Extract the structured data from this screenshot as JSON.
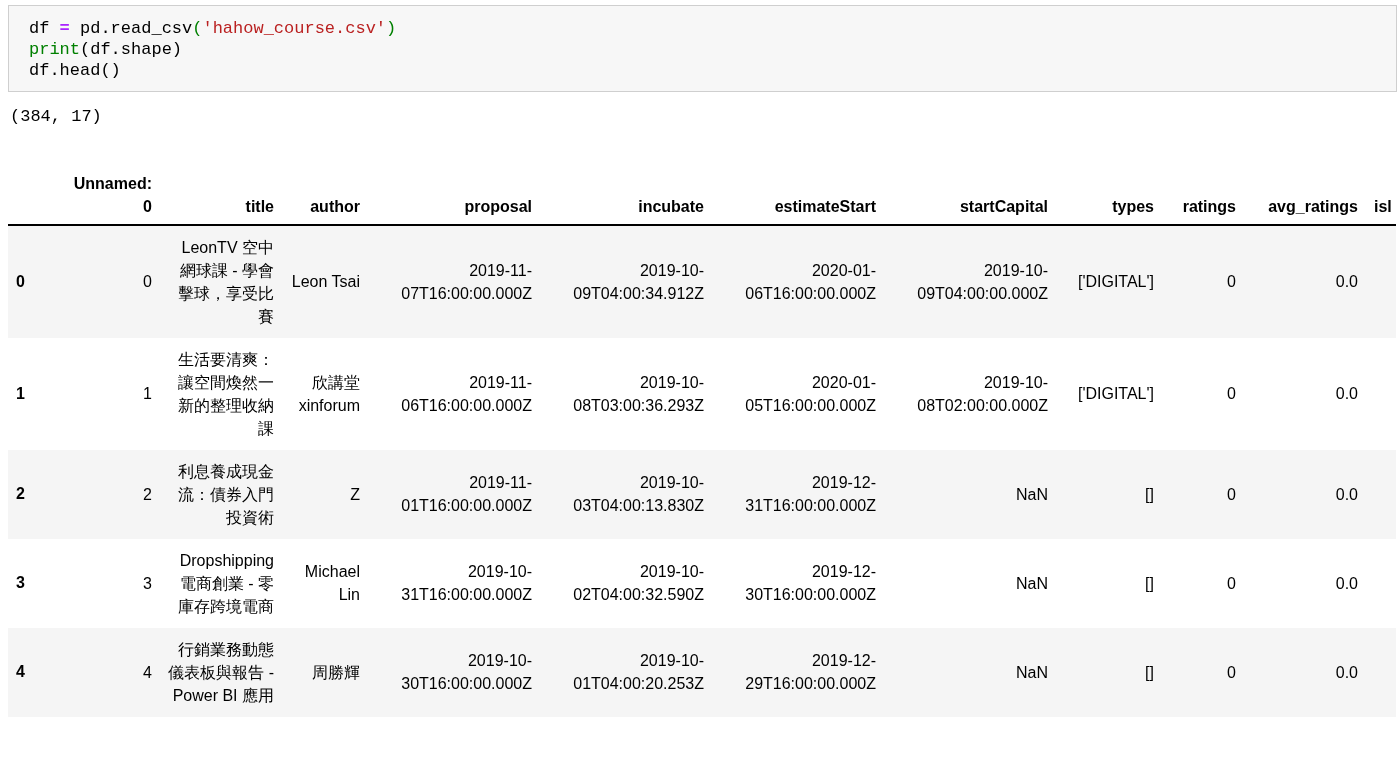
{
  "code_cell": {
    "lines": [
      [
        {
          "text": "df ",
          "kind": "plain"
        },
        {
          "text": "=",
          "kind": "operator"
        },
        {
          "text": " pd.read_csv",
          "kind": "plain"
        },
        {
          "text": "(",
          "kind": "paren"
        },
        {
          "text": "'hahow_course.csv'",
          "kind": "string"
        },
        {
          "text": ")",
          "kind": "paren"
        }
      ],
      [
        {
          "text": "print",
          "kind": "builtin"
        },
        {
          "text": "(df.shape)",
          "kind": "plain"
        }
      ],
      [
        {
          "text": "df.head()",
          "kind": "plain"
        }
      ]
    ]
  },
  "output": {
    "text": "(384, 17)"
  },
  "table": {
    "columns": [
      "Unnamed: 0",
      "title",
      "author",
      "proposal",
      "incubate",
      "estimateStart",
      "startCapital",
      "types",
      "ratings",
      "avg_ratings",
      "isl"
    ],
    "rows": [
      {
        "index": "0",
        "cells": [
          "0",
          "LeonTV 空中網球課 - 學會擊球，享受比賽",
          "Leon Tsai",
          "2019-11-07T16:00:00.000Z",
          "2019-10-09T04:00:34.912Z",
          "2020-01-06T16:00:00.000Z",
          "2019-10-09T04:00:00.000Z",
          "['DIGITAL']",
          "0",
          "0.0"
        ]
      },
      {
        "index": "1",
        "cells": [
          "1",
          "生活要清爽：讓空間煥然一新的整理收納課",
          "欣講堂 xinforum",
          "2019-11-06T16:00:00.000Z",
          "2019-10-08T03:00:36.293Z",
          "2020-01-05T16:00:00.000Z",
          "2019-10-08T02:00:00.000Z",
          "['DIGITAL']",
          "0",
          "0.0"
        ]
      },
      {
        "index": "2",
        "cells": [
          "2",
          "利息養成現金流：債券入門投資術",
          "Z",
          "2019-11-01T16:00:00.000Z",
          "2019-10-03T04:00:13.830Z",
          "2019-12-31T16:00:00.000Z",
          "NaN",
          "[]",
          "0",
          "0.0"
        ]
      },
      {
        "index": "3",
        "cells": [
          "3",
          "Dropshipping 電商創業 - 零庫存跨境電商",
          "Michael Lin",
          "2019-10-31T16:00:00.000Z",
          "2019-10-02T04:00:32.590Z",
          "2019-12-30T16:00:00.000Z",
          "NaN",
          "[]",
          "0",
          "0.0"
        ]
      },
      {
        "index": "4",
        "cells": [
          "4",
          "行銷業務動態儀表板與報告 - Power BI 應用",
          "周勝輝",
          "2019-10-30T16:00:00.000Z",
          "2019-10-01T04:00:20.253Z",
          "2019-12-29T16:00:00.000Z",
          "NaN",
          "[]",
          "0",
          "0.0"
        ]
      }
    ]
  }
}
